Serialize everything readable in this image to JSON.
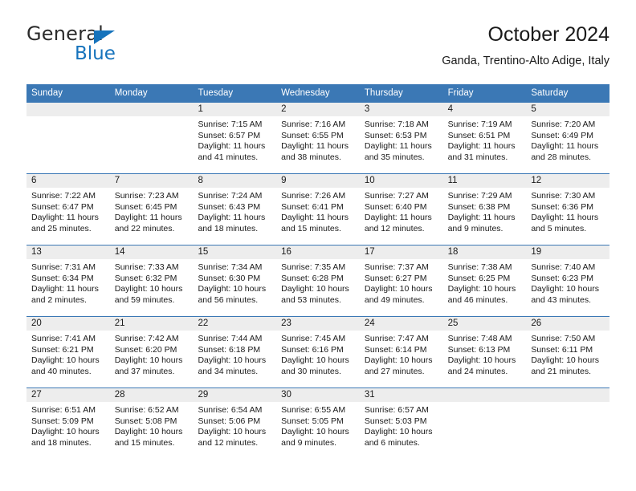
{
  "brand": {
    "name_part1": "General",
    "name_part2": "Blue",
    "accent_color": "#1673bc",
    "triangle_icon": "triangle-icon"
  },
  "header": {
    "title": "October 2024",
    "subtitle": "Ganda, Trentino-Alto Adige, Italy"
  },
  "theme": {
    "header_blue": "#3b78b5",
    "daynum_gray": "#ededed",
    "text": "#1a1a1a"
  },
  "weekdays": [
    "Sunday",
    "Monday",
    "Tuesday",
    "Wednesday",
    "Thursday",
    "Friday",
    "Saturday"
  ],
  "labels": {
    "sunrise_prefix": "Sunrise:",
    "sunset_prefix": "Sunset:",
    "daylight_prefix": "Daylight:"
  },
  "weeks": [
    [
      {
        "day": "",
        "sunrise": "",
        "sunset": "",
        "daylight_line1": "",
        "daylight_line2": ""
      },
      {
        "day": "",
        "sunrise": "",
        "sunset": "",
        "daylight_line1": "",
        "daylight_line2": ""
      },
      {
        "day": "1",
        "sunrise": "Sunrise: 7:15 AM",
        "sunset": "Sunset: 6:57 PM",
        "daylight_line1": "Daylight: 11 hours",
        "daylight_line2": "and 41 minutes."
      },
      {
        "day": "2",
        "sunrise": "Sunrise: 7:16 AM",
        "sunset": "Sunset: 6:55 PM",
        "daylight_line1": "Daylight: 11 hours",
        "daylight_line2": "and 38 minutes."
      },
      {
        "day": "3",
        "sunrise": "Sunrise: 7:18 AM",
        "sunset": "Sunset: 6:53 PM",
        "daylight_line1": "Daylight: 11 hours",
        "daylight_line2": "and 35 minutes."
      },
      {
        "day": "4",
        "sunrise": "Sunrise: 7:19 AM",
        "sunset": "Sunset: 6:51 PM",
        "daylight_line1": "Daylight: 11 hours",
        "daylight_line2": "and 31 minutes."
      },
      {
        "day": "5",
        "sunrise": "Sunrise: 7:20 AM",
        "sunset": "Sunset: 6:49 PM",
        "daylight_line1": "Daylight: 11 hours",
        "daylight_line2": "and 28 minutes."
      }
    ],
    [
      {
        "day": "6",
        "sunrise": "Sunrise: 7:22 AM",
        "sunset": "Sunset: 6:47 PM",
        "daylight_line1": "Daylight: 11 hours",
        "daylight_line2": "and 25 minutes."
      },
      {
        "day": "7",
        "sunrise": "Sunrise: 7:23 AM",
        "sunset": "Sunset: 6:45 PM",
        "daylight_line1": "Daylight: 11 hours",
        "daylight_line2": "and 22 minutes."
      },
      {
        "day": "8",
        "sunrise": "Sunrise: 7:24 AM",
        "sunset": "Sunset: 6:43 PM",
        "daylight_line1": "Daylight: 11 hours",
        "daylight_line2": "and 18 minutes."
      },
      {
        "day": "9",
        "sunrise": "Sunrise: 7:26 AM",
        "sunset": "Sunset: 6:41 PM",
        "daylight_line1": "Daylight: 11 hours",
        "daylight_line2": "and 15 minutes."
      },
      {
        "day": "10",
        "sunrise": "Sunrise: 7:27 AM",
        "sunset": "Sunset: 6:40 PM",
        "daylight_line1": "Daylight: 11 hours",
        "daylight_line2": "and 12 minutes."
      },
      {
        "day": "11",
        "sunrise": "Sunrise: 7:29 AM",
        "sunset": "Sunset: 6:38 PM",
        "daylight_line1": "Daylight: 11 hours",
        "daylight_line2": "and 9 minutes."
      },
      {
        "day": "12",
        "sunrise": "Sunrise: 7:30 AM",
        "sunset": "Sunset: 6:36 PM",
        "daylight_line1": "Daylight: 11 hours",
        "daylight_line2": "and 5 minutes."
      }
    ],
    [
      {
        "day": "13",
        "sunrise": "Sunrise: 7:31 AM",
        "sunset": "Sunset: 6:34 PM",
        "daylight_line1": "Daylight: 11 hours",
        "daylight_line2": "and 2 minutes."
      },
      {
        "day": "14",
        "sunrise": "Sunrise: 7:33 AM",
        "sunset": "Sunset: 6:32 PM",
        "daylight_line1": "Daylight: 10 hours",
        "daylight_line2": "and 59 minutes."
      },
      {
        "day": "15",
        "sunrise": "Sunrise: 7:34 AM",
        "sunset": "Sunset: 6:30 PM",
        "daylight_line1": "Daylight: 10 hours",
        "daylight_line2": "and 56 minutes."
      },
      {
        "day": "16",
        "sunrise": "Sunrise: 7:35 AM",
        "sunset": "Sunset: 6:28 PM",
        "daylight_line1": "Daylight: 10 hours",
        "daylight_line2": "and 53 minutes."
      },
      {
        "day": "17",
        "sunrise": "Sunrise: 7:37 AM",
        "sunset": "Sunset: 6:27 PM",
        "daylight_line1": "Daylight: 10 hours",
        "daylight_line2": "and 49 minutes."
      },
      {
        "day": "18",
        "sunrise": "Sunrise: 7:38 AM",
        "sunset": "Sunset: 6:25 PM",
        "daylight_line1": "Daylight: 10 hours",
        "daylight_line2": "and 46 minutes."
      },
      {
        "day": "19",
        "sunrise": "Sunrise: 7:40 AM",
        "sunset": "Sunset: 6:23 PM",
        "daylight_line1": "Daylight: 10 hours",
        "daylight_line2": "and 43 minutes."
      }
    ],
    [
      {
        "day": "20",
        "sunrise": "Sunrise: 7:41 AM",
        "sunset": "Sunset: 6:21 PM",
        "daylight_line1": "Daylight: 10 hours",
        "daylight_line2": "and 40 minutes."
      },
      {
        "day": "21",
        "sunrise": "Sunrise: 7:42 AM",
        "sunset": "Sunset: 6:20 PM",
        "daylight_line1": "Daylight: 10 hours",
        "daylight_line2": "and 37 minutes."
      },
      {
        "day": "22",
        "sunrise": "Sunrise: 7:44 AM",
        "sunset": "Sunset: 6:18 PM",
        "daylight_line1": "Daylight: 10 hours",
        "daylight_line2": "and 34 minutes."
      },
      {
        "day": "23",
        "sunrise": "Sunrise: 7:45 AM",
        "sunset": "Sunset: 6:16 PM",
        "daylight_line1": "Daylight: 10 hours",
        "daylight_line2": "and 30 minutes."
      },
      {
        "day": "24",
        "sunrise": "Sunrise: 7:47 AM",
        "sunset": "Sunset: 6:14 PM",
        "daylight_line1": "Daylight: 10 hours",
        "daylight_line2": "and 27 minutes."
      },
      {
        "day": "25",
        "sunrise": "Sunrise: 7:48 AM",
        "sunset": "Sunset: 6:13 PM",
        "daylight_line1": "Daylight: 10 hours",
        "daylight_line2": "and 24 minutes."
      },
      {
        "day": "26",
        "sunrise": "Sunrise: 7:50 AM",
        "sunset": "Sunset: 6:11 PM",
        "daylight_line1": "Daylight: 10 hours",
        "daylight_line2": "and 21 minutes."
      }
    ],
    [
      {
        "day": "27",
        "sunrise": "Sunrise: 6:51 AM",
        "sunset": "Sunset: 5:09 PM",
        "daylight_line1": "Daylight: 10 hours",
        "daylight_line2": "and 18 minutes."
      },
      {
        "day": "28",
        "sunrise": "Sunrise: 6:52 AM",
        "sunset": "Sunset: 5:08 PM",
        "daylight_line1": "Daylight: 10 hours",
        "daylight_line2": "and 15 minutes."
      },
      {
        "day": "29",
        "sunrise": "Sunrise: 6:54 AM",
        "sunset": "Sunset: 5:06 PM",
        "daylight_line1": "Daylight: 10 hours",
        "daylight_line2": "and 12 minutes."
      },
      {
        "day": "30",
        "sunrise": "Sunrise: 6:55 AM",
        "sunset": "Sunset: 5:05 PM",
        "daylight_line1": "Daylight: 10 hours",
        "daylight_line2": "and 9 minutes."
      },
      {
        "day": "31",
        "sunrise": "Sunrise: 6:57 AM",
        "sunset": "Sunset: 5:03 PM",
        "daylight_line1": "Daylight: 10 hours",
        "daylight_line2": "and 6 minutes."
      },
      {
        "day": "",
        "sunrise": "",
        "sunset": "",
        "daylight_line1": "",
        "daylight_line2": ""
      },
      {
        "day": "",
        "sunrise": "",
        "sunset": "",
        "daylight_line1": "",
        "daylight_line2": ""
      }
    ]
  ]
}
